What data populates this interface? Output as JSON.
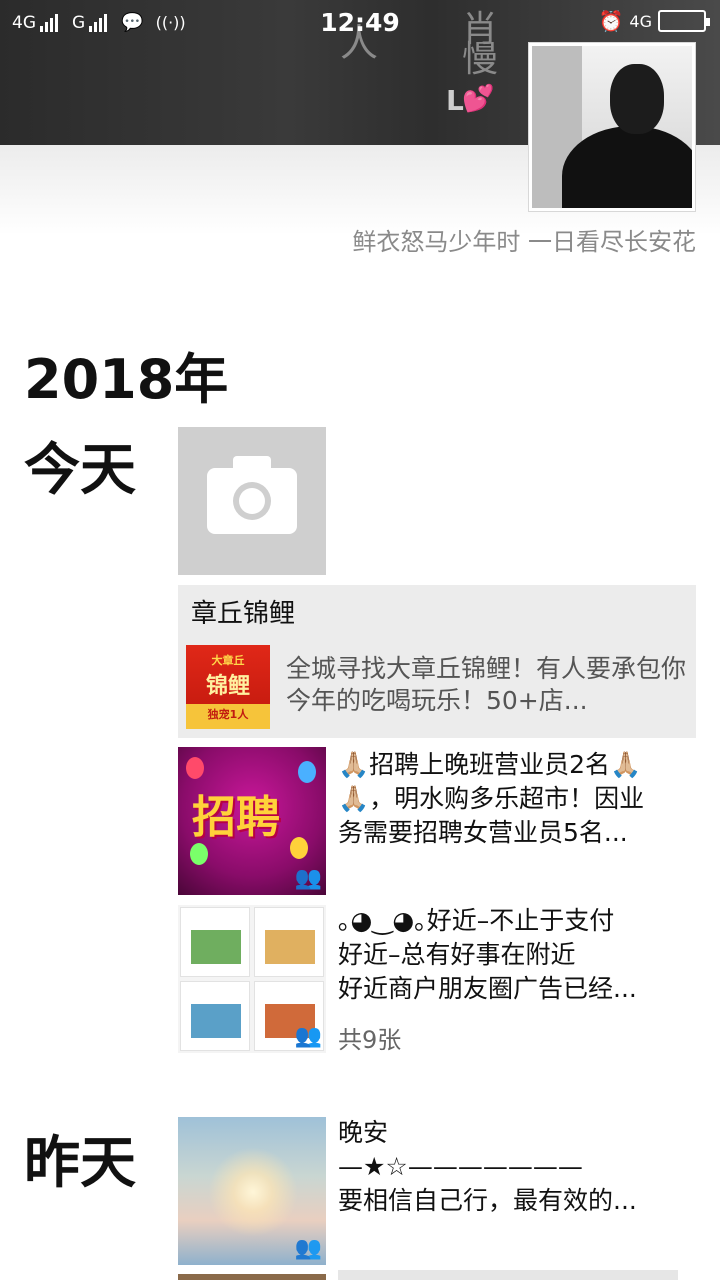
{
  "status_bar": {
    "network_1": "4G",
    "network_2": "G",
    "time": "12:49",
    "battery_network": "4G"
  },
  "profile": {
    "nickname_letter": "L",
    "heart": "💕",
    "signature": "鲜衣怒马少年时 一日看尽长安花",
    "cover_glyphs": [
      "人",
      "肖",
      "慢"
    ]
  },
  "timeline": {
    "year": "2018年",
    "sections": [
      {
        "day": "今天",
        "posts": [
          {
            "type": "camera",
            "icon": "camera-icon"
          },
          {
            "type": "share",
            "title": "章丘锦鲤",
            "thumb_lines": [
              "大章丘",
              "锦鲤",
              "独宠1人"
            ],
            "summary": "全城寻找大章丘锦鲤！有人要承包你今年的吃喝玩乐！50+店..."
          },
          {
            "type": "photo",
            "thumb_text": "招聘",
            "lines": [
              "🙏🏼招聘上晚班营业员2名🙏🏼",
              "🙏🏼，明水购多乐超市！因业",
              "务需要招聘女营业员5名..."
            ]
          },
          {
            "type": "photo",
            "lines": [
              "｡◕‿◕｡好近–不止于支付",
              "好近–总有好事在附近",
              "好近商户朋友圈广告已经..."
            ],
            "count": "共9张"
          }
        ]
      },
      {
        "day": "昨天",
        "posts": [
          {
            "type": "photo",
            "lines": [
              "晚安",
              "—★☆———————",
              "要相信自己行，最有效的..."
            ]
          }
        ]
      }
    ]
  },
  "colors": {
    "cover": "#2e2e2e",
    "card_bg": "#ececec",
    "signature": "#8a8a8a",
    "heart": "#e84f9c"
  }
}
